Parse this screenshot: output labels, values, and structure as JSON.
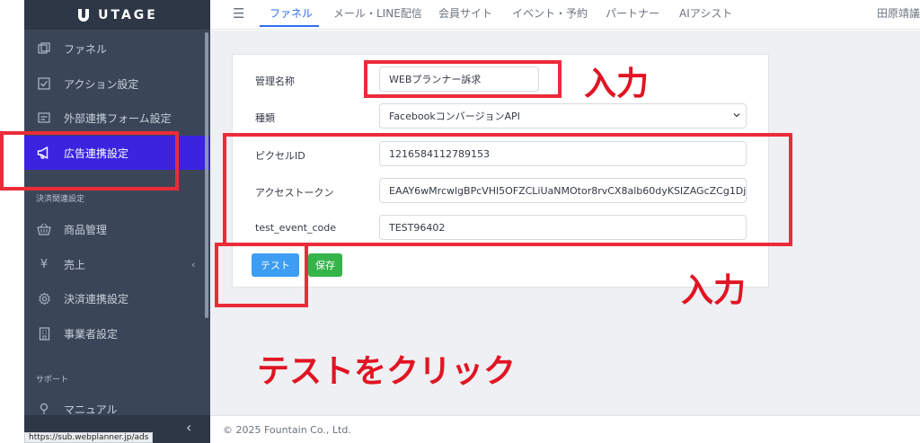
{
  "app": {
    "logo_text": "UTAGE"
  },
  "sidebar": {
    "items": [
      {
        "label": "ファネル",
        "icon": "funnel-icon"
      },
      {
        "label": "アクション設定",
        "icon": "checkbox-icon"
      },
      {
        "label": "外部連携フォーム設定",
        "icon": "form-icon"
      },
      {
        "label": "広告連携設定",
        "icon": "megaphone-icon",
        "active": true
      },
      {
        "label": "商品管理",
        "icon": "basket-icon"
      },
      {
        "label": "売上",
        "icon": "yen-icon"
      },
      {
        "label": "決済連携設定",
        "icon": "gear-icon"
      },
      {
        "label": "事業者設定",
        "icon": "building-icon"
      },
      {
        "label": "マニュアル",
        "icon": "pin-icon"
      }
    ],
    "sections": {
      "payment": "決済関連設定",
      "support": "サポート"
    }
  },
  "topnav": {
    "tabs": [
      "ファネル",
      "メール・LINE配信",
      "会員サイト",
      "イベント・予約",
      "パートナー",
      "AIアシスト"
    ],
    "active_tab": "ファネル",
    "user": "田原靖議"
  },
  "form": {
    "name_label": "管理名称",
    "name_value": "WEBプランナー訴求",
    "type_label": "種類",
    "type_value": "FacebookコンバージョンAPI",
    "pixel_label": "ピクセルID",
    "pixel_value": "1216584112789153",
    "token_label": "アクセストークン",
    "token_value": "EAAY6wMrcwlgBPcVHl5OFZCLiUaNMOtor8rvCX8alb60dyKSIZAGcZCg1Dj",
    "event_label": "test_event_code",
    "event_value": "TEST96402",
    "test_button": "テスト",
    "save_button": "保存"
  },
  "annotations": {
    "input_1": "入力",
    "input_2": "入力",
    "click_test": "テストをクリック"
  },
  "footer": {
    "copyright": "© 2025 Fountain Co., Ltd."
  },
  "status_url": "https://sub.webplanner.jp/ads",
  "colors": {
    "sidebar_bg": "#3a4658",
    "active_item": "#3b23e0",
    "accent_blue": "#2b6ff0",
    "annotation_red": "#e11423",
    "test_button": "#3d9df3",
    "save_button": "#35b449"
  }
}
